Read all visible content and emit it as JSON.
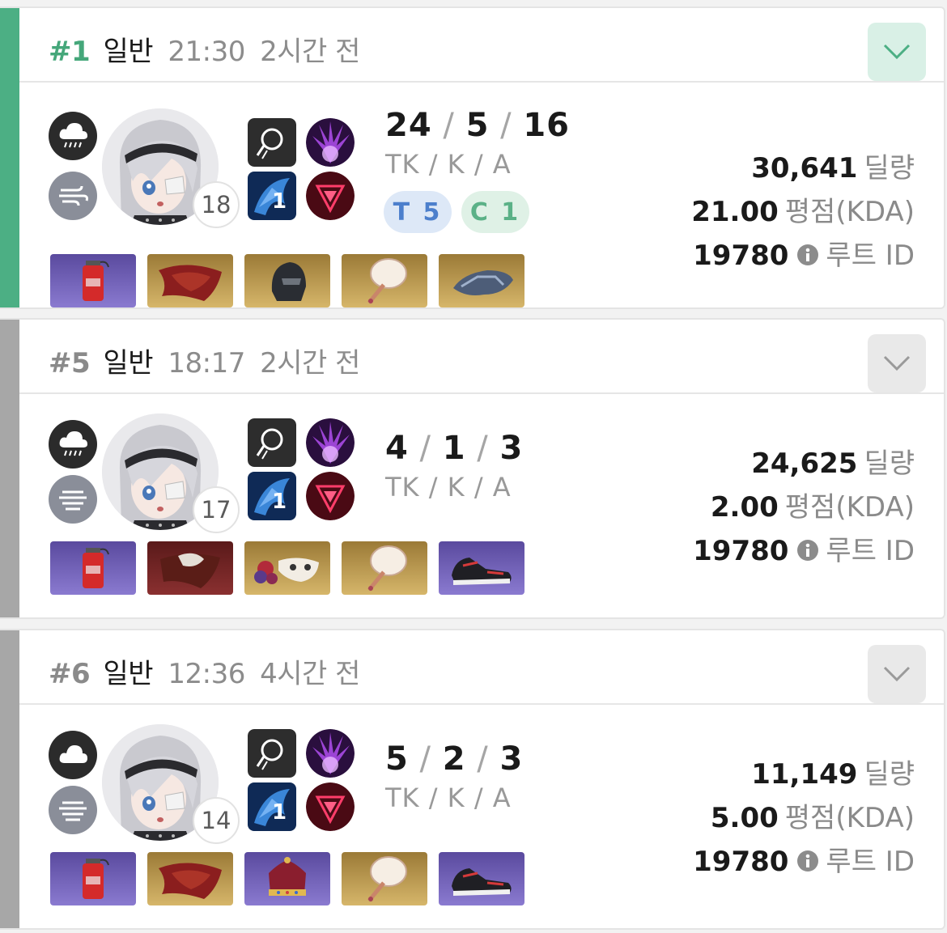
{
  "games": [
    {
      "rank": "#1",
      "mode": "일반",
      "time": "21:30",
      "ago": "2시간 전",
      "result": "win",
      "weather_icon": "rain-cloud-icon",
      "sub_icon": "wind-icon",
      "level": "18",
      "skill_level": "1",
      "kda": {
        "tk": "24",
        "k": "5",
        "a": "16"
      },
      "kda_label": "TK / K / A",
      "badges": {
        "tier": "T 5",
        "clan": "C 1"
      },
      "damage": "30,641",
      "damage_unit": "딜량",
      "rating": "21.00",
      "rating_unit": "평점(KDA)",
      "root_id": "19780",
      "root_id_unit": "루트 ID",
      "items": [
        "grenade-item",
        "red-cloak-item",
        "black-helmet-item",
        "fan-item",
        "gauntlet-item"
      ]
    },
    {
      "rank": "#5",
      "mode": "일반",
      "time": "18:17",
      "ago": "2시간 전",
      "result": "loss",
      "weather_icon": "rain-cloud-icon",
      "sub_icon": "fog-icon",
      "level": "17",
      "skill_level": "1",
      "kda": {
        "tk": "4",
        "k": "1",
        "a": "3"
      },
      "kda_label": "TK / K / A",
      "damage": "24,625",
      "damage_unit": "딜량",
      "rating": "2.00",
      "rating_unit": "평점(KDA)",
      "root_id": "19780",
      "root_id_unit": "루트 ID",
      "items": [
        "grenade-item",
        "dark-cloak-item",
        "rose-mask-item",
        "fan-item",
        "sneakers-item"
      ]
    },
    {
      "rank": "#6",
      "mode": "일반",
      "time": "12:36",
      "ago": "4시간 전",
      "result": "loss",
      "weather_icon": "cloud-icon",
      "sub_icon": "fog-icon",
      "level": "14",
      "skill_level": "1",
      "kda": {
        "tk": "5",
        "k": "2",
        "a": "3"
      },
      "kda_label": "TK / K / A",
      "damage": "11,149",
      "damage_unit": "딜량",
      "rating": "5.00",
      "rating_unit": "평점(KDA)",
      "root_id": "19780",
      "root_id_unit": "루트 ID",
      "items": [
        "grenade-item",
        "red-cloak-item",
        "crown-item",
        "fan-item",
        "sneakers-item"
      ]
    }
  ]
}
